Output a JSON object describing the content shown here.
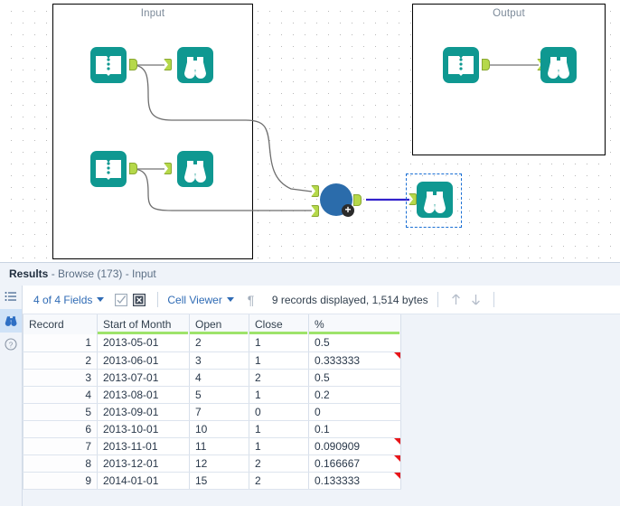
{
  "canvas": {
    "containers": [
      {
        "name": "input-container",
        "label": "Input"
      },
      {
        "name": "output-container",
        "label": "Output"
      }
    ],
    "icons": {
      "input_data": "input-data-icon",
      "browse": "browse-binoculars-icon",
      "join": "join-node-icon",
      "plus_badge": "+"
    }
  },
  "results": {
    "title": "Results",
    "subtitle": " - Browse (173) - Input",
    "rail": [
      {
        "name": "metadata-list-icon",
        "label": "Metadata"
      },
      {
        "name": "browse-binoculars-icon",
        "label": "Browse"
      },
      {
        "name": "help-question-icon",
        "label": "Help"
      }
    ],
    "toolbar": {
      "fields_label": "4 of 4 Fields",
      "select_all_label": "Select All Fields",
      "deselect_all_label": "Deselect All Fields",
      "viewer_label": "Cell Viewer",
      "pilcrow_label": "Show Whitespace",
      "records_label": "9 records displayed, 1,514 bytes",
      "prev_label": "Previous",
      "next_label": "Next"
    },
    "table": {
      "columns": [
        {
          "key": "record",
          "label": "Record",
          "underline": false
        },
        {
          "key": "month",
          "label": "Start of Month",
          "underline": true
        },
        {
          "key": "open",
          "label": "Open",
          "underline": true
        },
        {
          "key": "close",
          "label": "Close",
          "underline": true
        },
        {
          "key": "pct",
          "label": "%",
          "underline": true
        }
      ],
      "rows": [
        {
          "record": "1",
          "month": "2013-05-01",
          "open": "2",
          "close": "1",
          "pct": "0.5",
          "flag": false
        },
        {
          "record": "2",
          "month": "2013-06-01",
          "open": "3",
          "close": "1",
          "pct": "0.333333",
          "flag": true
        },
        {
          "record": "3",
          "month": "2013-07-01",
          "open": "4",
          "close": "2",
          "pct": "0.5",
          "flag": false
        },
        {
          "record": "4",
          "month": "2013-08-01",
          "open": "5",
          "close": "1",
          "pct": "0.2",
          "flag": false
        },
        {
          "record": "5",
          "month": "2013-09-01",
          "open": "7",
          "close": "0",
          "pct": "0",
          "flag": false
        },
        {
          "record": "6",
          "month": "2013-10-01",
          "open": "10",
          "close": "1",
          "pct": "0.1",
          "flag": false
        },
        {
          "record": "7",
          "month": "2013-11-01",
          "open": "11",
          "close": "1",
          "pct": "0.090909",
          "flag": true
        },
        {
          "record": "8",
          "month": "2013-12-01",
          "open": "12",
          "close": "2",
          "pct": "0.166667",
          "flag": true
        },
        {
          "record": "9",
          "month": "2014-01-01",
          "open": "15",
          "close": "2",
          "pct": "0.133333",
          "flag": true
        }
      ]
    }
  },
  "colors": {
    "tool_teal": "#0f9891",
    "anchor_green": "#b5d84a",
    "join_blue": "#2b6cab",
    "selected_wire": "#3322cc",
    "flag_red": "#e8161a",
    "header_underline": "#9ee36b",
    "link_blue": "#2f6bb5",
    "panel_bg": "#eff3f9"
  }
}
